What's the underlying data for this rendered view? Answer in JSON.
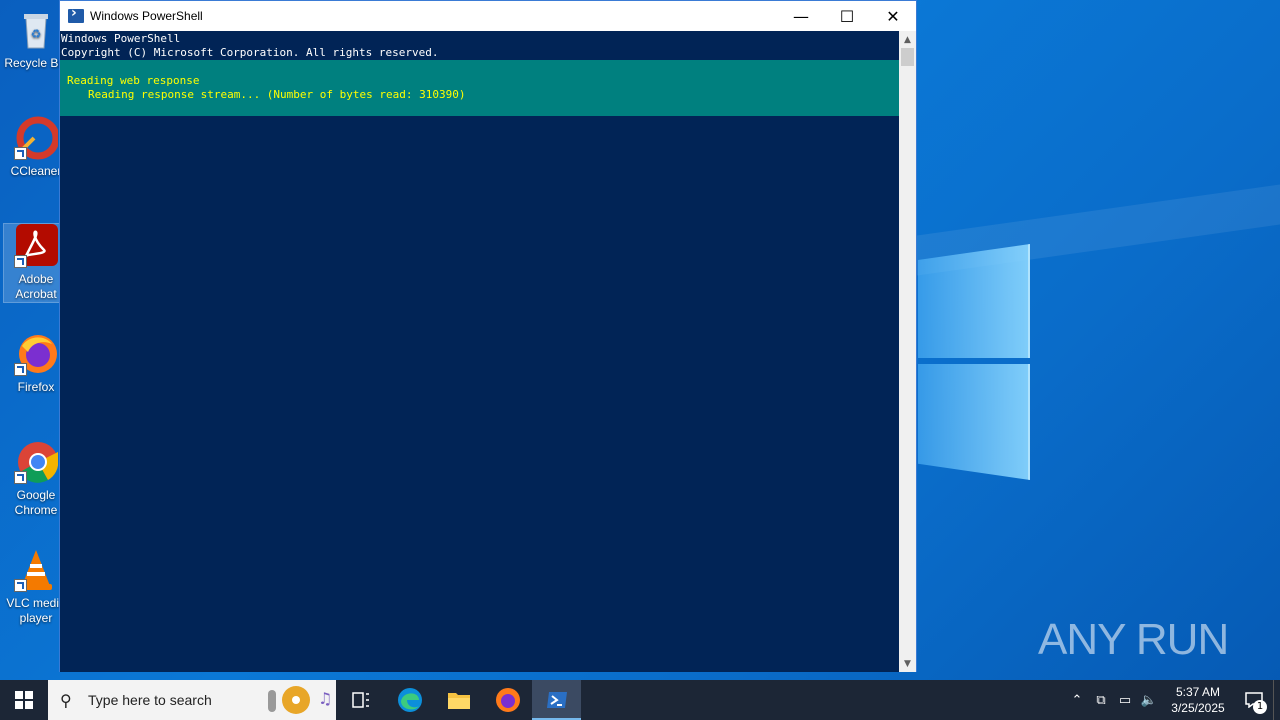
{
  "desktop": {
    "icons": [
      {
        "label": "Recycle Bin",
        "icon": "recycle-bin-icon"
      },
      {
        "label": "CCleaner",
        "icon": "ccleaner-icon"
      },
      {
        "label": "Adobe Acrobat",
        "icon": "adobe-acrobat-icon"
      },
      {
        "label": "Firefox",
        "icon": "firefox-icon"
      },
      {
        "label": "Google Chrome",
        "icon": "chrome-icon"
      },
      {
        "label": "VLC media player",
        "icon": "vlc-icon"
      }
    ],
    "watermark": "ANY RUN"
  },
  "window": {
    "title": "Windows PowerShell",
    "controls": {
      "minimize": "—",
      "maximize": "☐",
      "close": "✕"
    },
    "console": {
      "header_line1": "Windows PowerShell",
      "header_line2": "Copyright (C) Microsoft Corporation. All rights reserved.",
      "progress_line1": "Reading web response",
      "progress_line2": "Reading response stream... (Number of bytes read: 310390)"
    },
    "colors": {
      "console_bg": "#012456",
      "progress_bg": "#00807f",
      "progress_text": "#ffff00"
    }
  },
  "taskbar": {
    "search_placeholder": "Type here to search",
    "apps": [
      "task-view-icon",
      "edge-icon",
      "file-explorer-icon",
      "firefox-icon",
      "powershell-icon"
    ],
    "active_app": "powershell-icon",
    "clock_time": "5:37 AM",
    "clock_date": "3/25/2025",
    "notification_count": "1"
  }
}
